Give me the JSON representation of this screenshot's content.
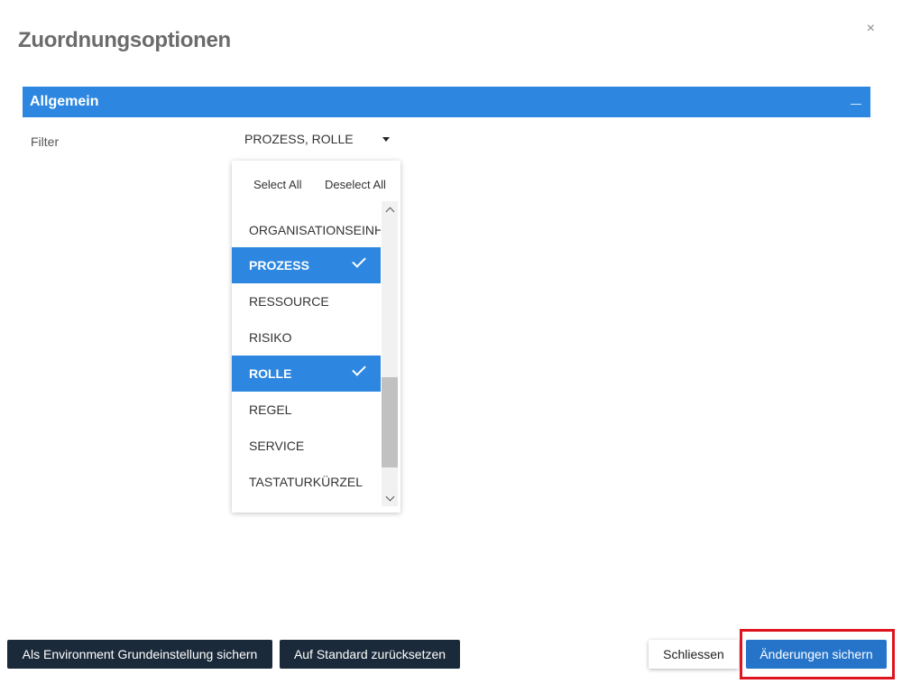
{
  "dialog": {
    "title": "Zuordnungsoptionen",
    "close_icon": "×"
  },
  "section": {
    "title": "Allgemein",
    "collapse_icon": "minus-icon"
  },
  "filter": {
    "label": "Filter",
    "value": "PROZESS, ROLLE"
  },
  "dropdown": {
    "select_all": "Select All",
    "deselect_all": "Deselect All",
    "items": [
      {
        "label": "ORGANISATIONSEINHEIT",
        "selected": false
      },
      {
        "label": "PROZESS",
        "selected": true
      },
      {
        "label": "RESSOURCE",
        "selected": false
      },
      {
        "label": "RISIKO",
        "selected": false
      },
      {
        "label": "ROLLE",
        "selected": true
      },
      {
        "label": "REGEL",
        "selected": false
      },
      {
        "label": "SERVICE",
        "selected": false
      },
      {
        "label": "TASTATURKÜRZEL",
        "selected": false
      }
    ]
  },
  "footer": {
    "env_button": "Als Environment Grundeinstellung sichern",
    "reset_button": "Auf Standard zurücksetzen",
    "close_button": "Schliessen",
    "save_button": "Änderungen sichern"
  },
  "colors": {
    "header_blue": "#2d87e0",
    "dark_button": "#1b2a3a",
    "save_blue": "#2574c9",
    "highlight_red": "#e0141e"
  }
}
